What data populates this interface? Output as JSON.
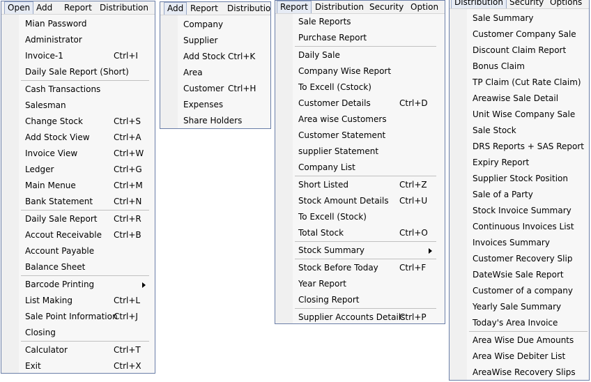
{
  "panels": [
    {
      "id": "open",
      "menubar": [
        "Open",
        "Add",
        "Report",
        "Distribution"
      ],
      "active": 0,
      "items": [
        {
          "label": "Mian Password",
          "shortcut": ""
        },
        {
          "label": "Administrator",
          "shortcut": ""
        },
        {
          "label": "Invoice-1",
          "shortcut": "Ctrl+I"
        },
        {
          "label": "Daily Sale Report (Short)",
          "shortcut": ""
        },
        {
          "sep": true
        },
        {
          "label": "Cash Transactions",
          "shortcut": ""
        },
        {
          "label": "Salesman",
          "shortcut": ""
        },
        {
          "label": "Change Stock",
          "shortcut": "Ctrl+S"
        },
        {
          "label": "Add Stock View",
          "shortcut": "Ctrl+A"
        },
        {
          "label": "Invoice View",
          "shortcut": "Ctrl+W"
        },
        {
          "label": "Ledger",
          "shortcut": "Ctrl+G"
        },
        {
          "label": "Main Menue",
          "shortcut": "Ctrl+M"
        },
        {
          "label": "Bank Statement",
          "shortcut": "Ctrl+N"
        },
        {
          "sep": true
        },
        {
          "label": "Daily Sale Report",
          "shortcut": "Ctrl+R"
        },
        {
          "label": "Accout Receivable",
          "shortcut": "Ctrl+B"
        },
        {
          "label": "Account Payable",
          "shortcut": ""
        },
        {
          "label": "Balance Sheet",
          "shortcut": ""
        },
        {
          "sep": true
        },
        {
          "label": "Barcode Printing",
          "shortcut": "",
          "submenu": true
        },
        {
          "label": "List Making",
          "shortcut": "Ctrl+L"
        },
        {
          "label": "Sale Point Information",
          "shortcut": "Ctrl+J"
        },
        {
          "label": "Closing",
          "shortcut": ""
        },
        {
          "sep": true
        },
        {
          "label": "Calculator",
          "shortcut": "Ctrl+T"
        },
        {
          "label": "Exit",
          "shortcut": "Ctrl+X"
        }
      ]
    },
    {
      "id": "add",
      "menubar": [
        "Add",
        "Report",
        "Distribution"
      ],
      "active": 0,
      "items": [
        {
          "label": "Company",
          "shortcut": ""
        },
        {
          "label": "Supplier",
          "shortcut": ""
        },
        {
          "label": "Add Stock",
          "shortcut": "Ctrl+K"
        },
        {
          "label": "Area",
          "shortcut": ""
        },
        {
          "label": "Customer",
          "shortcut": "Ctrl+H"
        },
        {
          "label": "Expenses",
          "shortcut": ""
        },
        {
          "label": "Share Holders",
          "shortcut": ""
        }
      ]
    },
    {
      "id": "report",
      "menubar": [
        "Report",
        "Distribution",
        "Security",
        "Option"
      ],
      "active": 0,
      "items": [
        {
          "label": "Sale Reports",
          "shortcut": ""
        },
        {
          "label": "Purchase Report",
          "shortcut": ""
        },
        {
          "sep": true
        },
        {
          "label": "Daily Sale",
          "shortcut": ""
        },
        {
          "label": "Company Wise Report",
          "shortcut": ""
        },
        {
          "label": "To Excell (Cstock)",
          "shortcut": ""
        },
        {
          "label": "Customer Details",
          "shortcut": "Ctrl+D"
        },
        {
          "label": "Area wise Customers",
          "shortcut": ""
        },
        {
          "label": "Customer Statement",
          "shortcut": ""
        },
        {
          "label": "supplier Statement",
          "shortcut": ""
        },
        {
          "label": "Company List",
          "shortcut": ""
        },
        {
          "sep": true
        },
        {
          "label": "Short Listed",
          "shortcut": "Ctrl+Z"
        },
        {
          "label": "Stock Amount Details",
          "shortcut": "Ctrl+U"
        },
        {
          "label": "To Excell (Stock)",
          "shortcut": ""
        },
        {
          "label": "Total Stock",
          "shortcut": "Ctrl+O"
        },
        {
          "sep": true
        },
        {
          "label": "Stock Summary",
          "shortcut": "",
          "submenu": true
        },
        {
          "sep": true
        },
        {
          "label": "Stock Before Today",
          "shortcut": "Ctrl+F"
        },
        {
          "label": "Year Report",
          "shortcut": ""
        },
        {
          "label": "Closing Report",
          "shortcut": ""
        },
        {
          "sep": true
        },
        {
          "label": "Supplier Accounts Details",
          "shortcut": "Ctrl+P"
        }
      ]
    },
    {
      "id": "distribution",
      "menubar": [
        "Distribution",
        "Security",
        "Options"
      ],
      "active": 0,
      "items": [
        {
          "label": "Sale Summary",
          "shortcut": ""
        },
        {
          "label": "Customer Company Sale",
          "shortcut": ""
        },
        {
          "label": "Discount Claim Report",
          "shortcut": ""
        },
        {
          "label": "Bonus Claim",
          "shortcut": ""
        },
        {
          "label": "TP Claim (Cut Rate Claim)",
          "shortcut": ""
        },
        {
          "label": "Areawise Sale Detail",
          "shortcut": ""
        },
        {
          "label": "Unit Wise Company Sale",
          "shortcut": ""
        },
        {
          "label": "Sale Stock",
          "shortcut": ""
        },
        {
          "label": "DRS Reports + SAS Report",
          "shortcut": ""
        },
        {
          "label": "Expiry Report",
          "shortcut": ""
        },
        {
          "label": "Supplier Stock Position",
          "shortcut": ""
        },
        {
          "label": "Sale of a Party",
          "shortcut": ""
        },
        {
          "label": "Stock Invoice Summary",
          "shortcut": ""
        },
        {
          "label": "Continuous Invoices List",
          "shortcut": ""
        },
        {
          "label": "Invoices Summary",
          "shortcut": ""
        },
        {
          "label": "Customer Recovery Slip",
          "shortcut": ""
        },
        {
          "label": "DateWsie Sale Report",
          "shortcut": ""
        },
        {
          "label": "Customer of a company",
          "shortcut": ""
        },
        {
          "label": "Yearly Sale Summary",
          "shortcut": ""
        },
        {
          "label": "Today's Area Invoice",
          "shortcut": ""
        },
        {
          "sep": true
        },
        {
          "label": "Area Wise Due Amounts",
          "shortcut": ""
        },
        {
          "label": "Area Wise Debiter List",
          "shortcut": ""
        },
        {
          "label": "AreaWise Recovery Slips",
          "shortcut": ""
        }
      ]
    }
  ]
}
